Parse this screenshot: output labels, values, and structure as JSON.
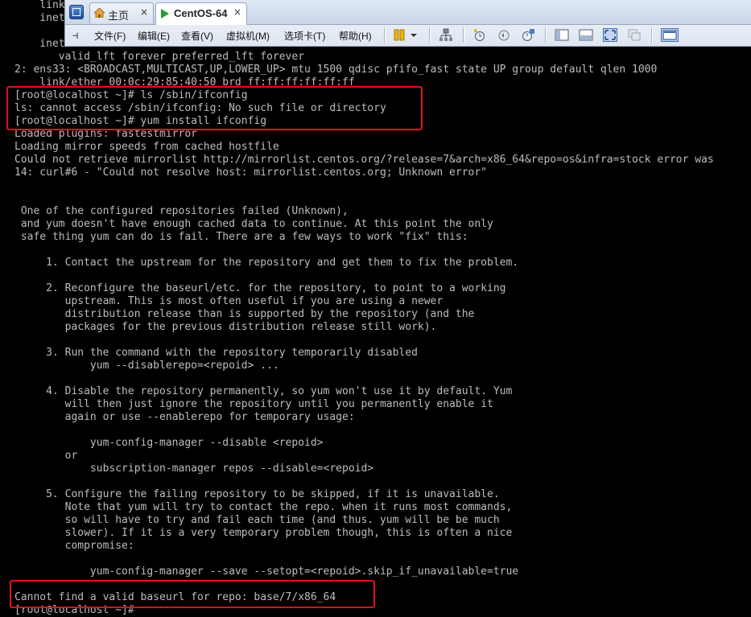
{
  "window": {
    "tabs": [
      {
        "label": "主页",
        "icon": "home-icon",
        "active": false
      },
      {
        "label": "CentOS-64",
        "icon": "vm-running-icon",
        "active": true
      }
    ],
    "close_glyph": "×",
    "menu": [
      "文件(F)",
      "编辑(E)",
      "查看(V)",
      "虚拟机(M)",
      "选项卡(T)",
      "帮助(H)"
    ]
  },
  "terminal": {
    "lines": [
      "    link",
      "    inet",
      "",
      "    inet",
      "       valid_lft forever preferred_lft forever",
      "2: ens33: <BROADCAST,MULTICAST,UP,LOWER_UP> mtu 1500 qdisc pfifo_fast state UP group default qlen 1000",
      "    link/ether 00:0c:29:85:40:50 brd ff:ff:ff:ff:ff:ff",
      "[root@localhost ~]# ls /sbin/ifconfig",
      "ls: cannot access /sbin/ifconfig: No such file or directory",
      "[root@localhost ~]# yum install ifconfig",
      "Loaded plugins: fastestmirror",
      "Loading mirror speeds from cached hostfile",
      "Could not retrieve mirrorlist http://mirrorlist.centos.org/?release=7&arch=x86_64&repo=os&infra=stock error was",
      "14: curl#6 - \"Could not resolve host: mirrorlist.centos.org; Unknown error\"",
      "",
      "",
      " One of the configured repositories failed (Unknown),",
      " and yum doesn't have enough cached data to continue. At this point the only",
      " safe thing yum can do is fail. There are a few ways to work \"fix\" this:",
      "",
      "     1. Contact the upstream for the repository and get them to fix the problem.",
      "",
      "     2. Reconfigure the baseurl/etc. for the repository, to point to a working",
      "        upstream. This is most often useful if you are using a newer",
      "        distribution release than is supported by the repository (and the",
      "        packages for the previous distribution release still work).",
      "",
      "     3. Run the command with the repository temporarily disabled",
      "            yum --disablerepo=<repoid> ...",
      "",
      "     4. Disable the repository permanently, so yum won't use it by default. Yum",
      "        will then just ignore the repository until you permanently enable it",
      "        again or use --enablerepo for temporary usage:",
      "",
      "            yum-config-manager --disable <repoid>",
      "        or",
      "            subscription-manager repos --disable=<repoid>",
      "",
      "     5. Configure the failing repository to be skipped, if it is unavailable.",
      "        Note that yum will try to contact the repo. when it runs most commands,",
      "        so will have to try and fail each time (and thus. yum will be be much",
      "        slower). If it is a very temporary problem though, this is often a nice",
      "        compromise:",
      "",
      "            yum-config-manager --save --setopt=<repoid>.skip_if_unavailable=true",
      "",
      "Cannot find a valid baseurl for repo: base/7/x86_64",
      "[root@localhost ~]#"
    ],
    "colors": {
      "background": "#000000",
      "text": "#bdbdbd",
      "highlight": "#e0101a"
    }
  }
}
